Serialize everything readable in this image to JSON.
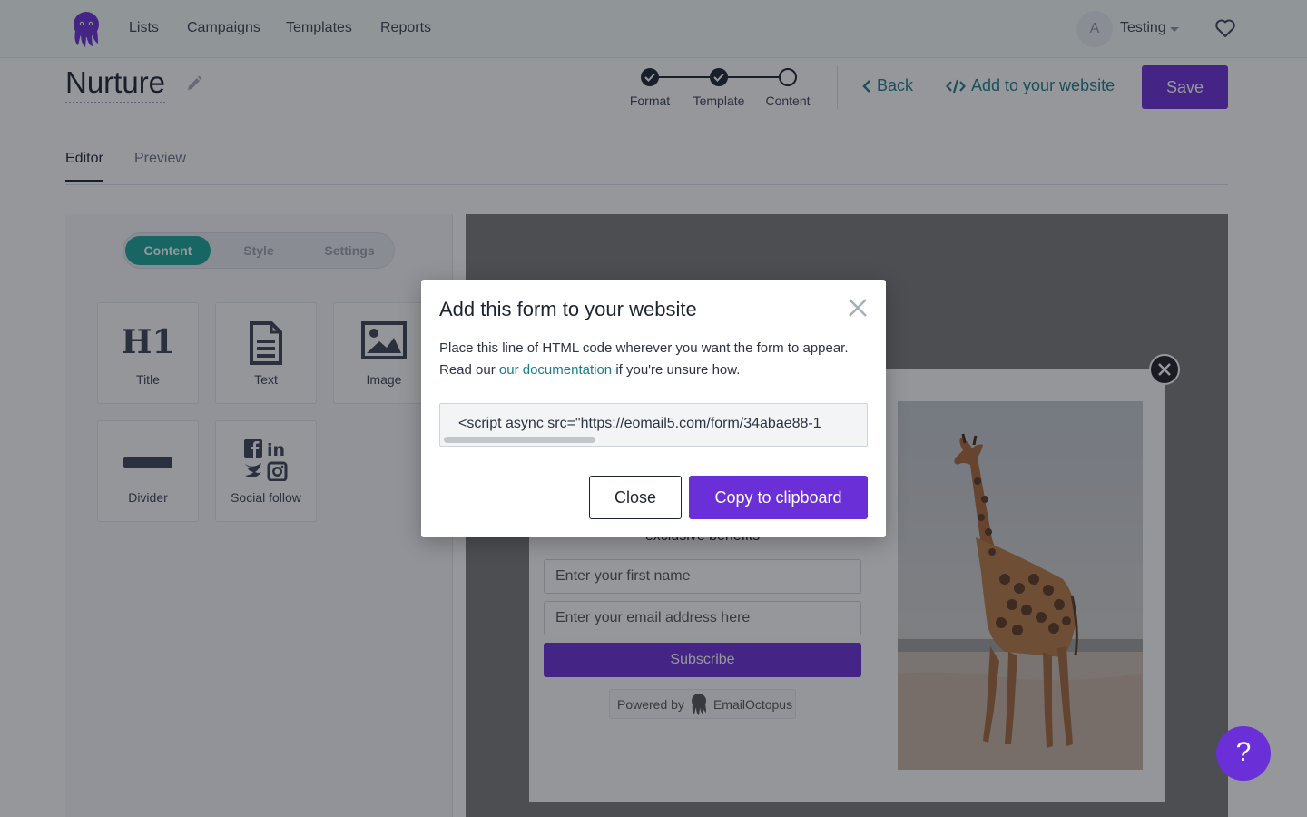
{
  "nav": {
    "links": [
      "Lists",
      "Campaigns",
      "Templates",
      "Reports"
    ],
    "user_initial": "A",
    "user_name": "Testing"
  },
  "page": {
    "title": "Nurture",
    "steps": [
      "Format",
      "Template",
      "Content"
    ],
    "back_label": "Back",
    "embed_label": "Add to your website",
    "save_label": "Save"
  },
  "tabs": [
    "Editor",
    "Preview"
  ],
  "sidebar": {
    "segments": [
      "Content",
      "Style",
      "Settings"
    ],
    "blocks": [
      "Title",
      "Text",
      "Image",
      "Divider",
      "Social follow"
    ]
  },
  "form_preview": {
    "text_fragment": "exclusive benefits",
    "first_name_placeholder": "Enter your first name",
    "email_placeholder": "Enter your email address here",
    "subscribe_label": "Subscribe",
    "powered_by": "Powered by",
    "brand": "EmailOctopus"
  },
  "modal": {
    "title": "Add this form to your website",
    "body_line1": "Place this line of HTML code wherever you want the form to appear.",
    "body_read": "Read our",
    "body_link": "our documentation",
    "body_end": "if you're unsure how.",
    "code": "<script async src=\"https://eomail5.com/form/34abae88-1",
    "close_label": "Close",
    "copy_label": "Copy to clipboard"
  },
  "help_label": "?",
  "colors": {
    "accent_purple": "#6a2fd6",
    "teal": "#1f7c8a",
    "segment_active": "#1aa79a"
  }
}
